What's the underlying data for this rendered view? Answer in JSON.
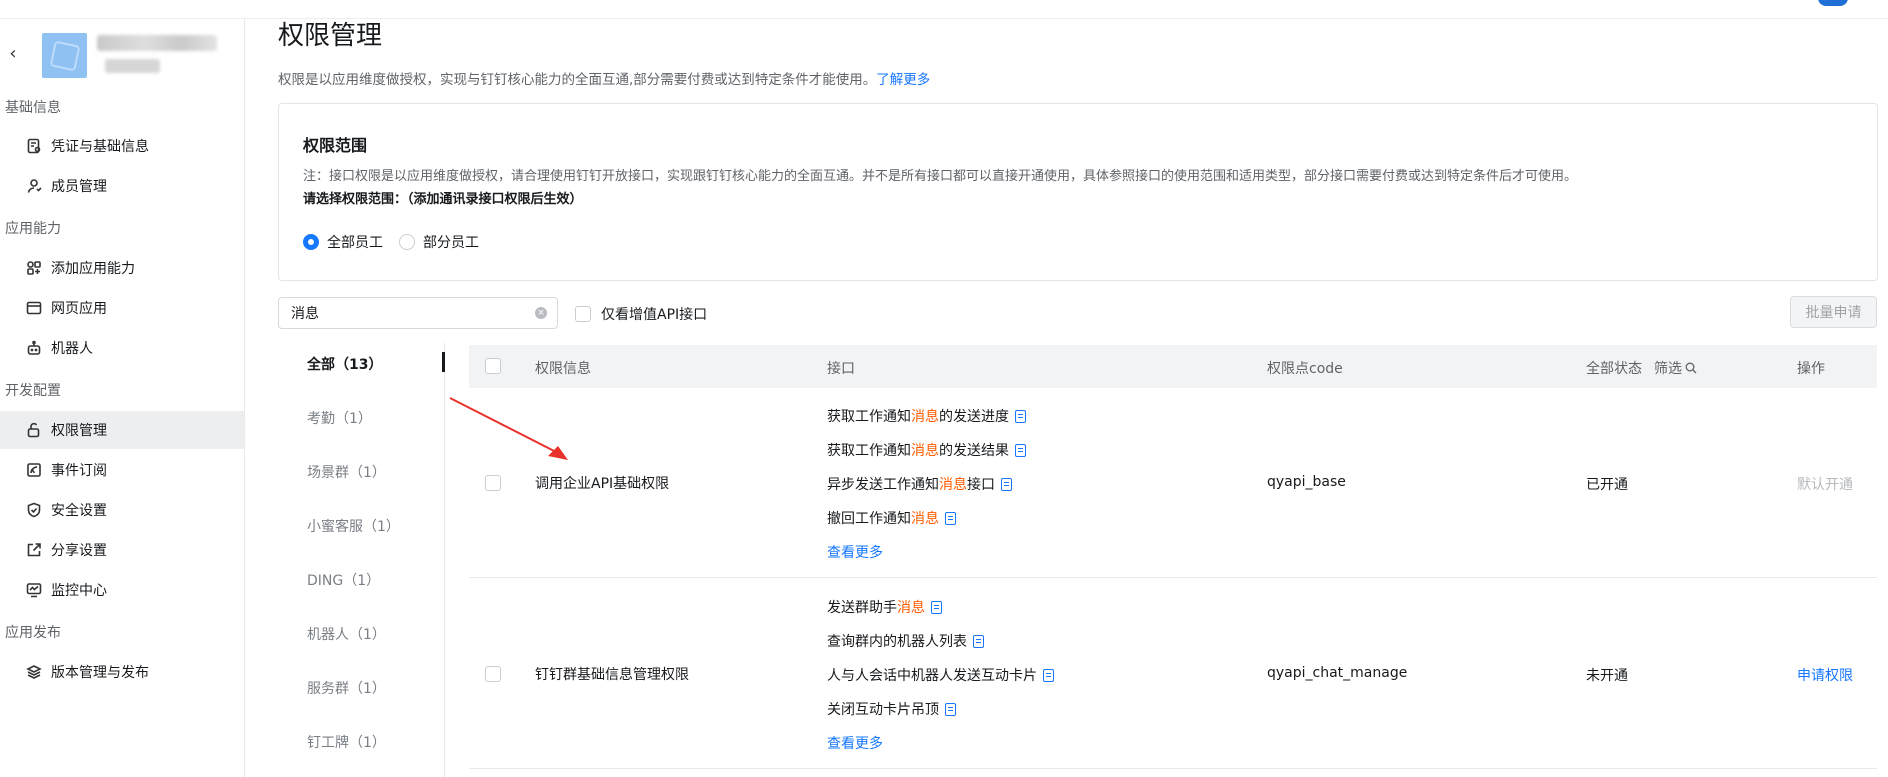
{
  "sidebar": {
    "back_icon": "chevron-left-icon",
    "groups": [
      {
        "label": "基础信息",
        "items": [
          {
            "label": "凭证与基础信息",
            "icon": "credential-icon"
          },
          {
            "label": "成员管理",
            "icon": "user-icon"
          }
        ]
      },
      {
        "label": "应用能力",
        "items": [
          {
            "label": "添加应用能力",
            "icon": "apps-icon"
          },
          {
            "label": "网页应用",
            "icon": "browser-icon"
          },
          {
            "label": "机器人",
            "icon": "robot-icon"
          }
        ]
      },
      {
        "label": "开发配置",
        "items": [
          {
            "label": "权限管理",
            "icon": "lock-icon",
            "active": true
          },
          {
            "label": "事件订阅",
            "icon": "event-icon"
          },
          {
            "label": "安全设置",
            "icon": "shield-icon"
          },
          {
            "label": "分享设置",
            "icon": "share-icon"
          },
          {
            "label": "监控中心",
            "icon": "monitor-icon"
          }
        ]
      },
      {
        "label": "应用发布",
        "items": [
          {
            "label": "版本管理与发布",
            "icon": "layers-icon"
          }
        ]
      }
    ]
  },
  "main": {
    "title": "权限管理",
    "description": "权限是以应用维度做授权，实现与钉钉核心能力的全面互通,部分需要付费或达到特定条件才能使用。",
    "learn_more": "了解更多",
    "scope": {
      "title": "权限范围",
      "note": "注：接口权限是以应用维度做授权，请合理使用钉钉开放接口，实现跟钉钉核心能力的全面互通。并不是所有接口都可以直接开通使用，具体参照接口的使用范围和适用类型，部分接口需要付费或达到特定条件后才可使用。",
      "ask": "请选择权限范围：（添加通讯录接口权限后生效）",
      "options": [
        {
          "label": "全部员工",
          "selected": true
        },
        {
          "label": "部分员工",
          "selected": false
        }
      ]
    },
    "search": {
      "value": "消息"
    },
    "value_added_only": "仅看增值API接口",
    "batch_apply": "批量申请",
    "categories": [
      "全部（13）",
      "考勤（1）",
      "场景群（1）",
      "小蜜客服（1）",
      "DING（1）",
      "机器人（1）",
      "服务群（1）",
      "钉工牌（1）"
    ],
    "table": {
      "headers": {
        "info": "权限信息",
        "api": "接口",
        "code": "权限点code",
        "status": "全部状态",
        "filter": "筛选",
        "action": "操作"
      },
      "rows": [
        {
          "name": "调用企业API基础权限",
          "apis": [
            {
              "pre": "获取工作通知",
              "hl": "消息",
              "post": "的发送进度"
            },
            {
              "pre": "获取工作通知",
              "hl": "消息",
              "post": "的发送结果"
            },
            {
              "pre": "异步发送工作通知",
              "hl": "消息",
              "post": "接口"
            },
            {
              "pre": "撤回工作通知",
              "hl": "消息",
              "post": ""
            }
          ],
          "more": "查看更多",
          "code": "qyapi_base",
          "status": "已开通",
          "action": "默认开通"
        },
        {
          "name": "钉钉群基础信息管理权限",
          "apis": [
            {
              "pre": "发送群助手",
              "hl": "消息",
              "post": ""
            },
            {
              "pre": "查询群内的机器人列表",
              "hl": "",
              "post": ""
            },
            {
              "pre": "人与人会话中机器人发送互动卡片",
              "hl": "",
              "post": ""
            },
            {
              "pre": "关闭互动卡片吊顶",
              "hl": "",
              "post": ""
            }
          ],
          "more": "查看更多",
          "code": "qyapi_chat_manage",
          "status": "未开通",
          "action": "申请权限"
        }
      ]
    }
  },
  "colors": {
    "accent": "#1677ff",
    "highlight": "#ff5c00",
    "arrow": "#e8322b"
  }
}
